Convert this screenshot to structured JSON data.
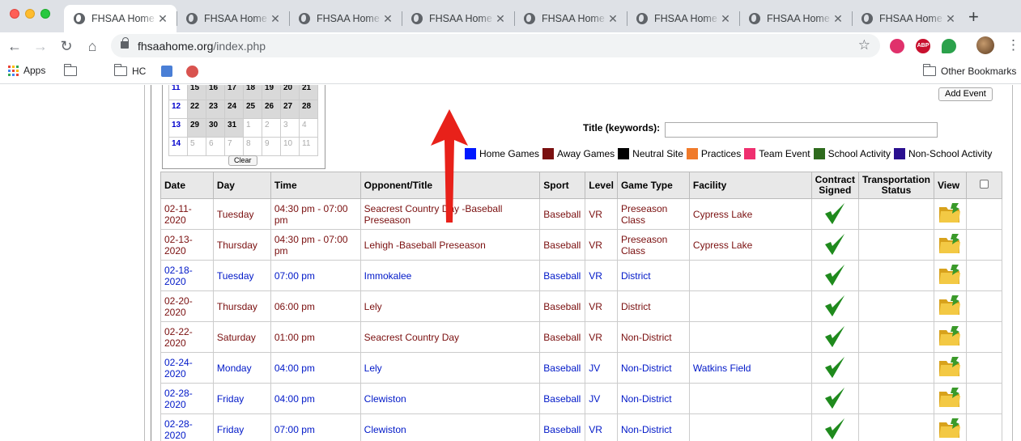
{
  "browser": {
    "tabs": [
      {
        "title": "FHSAA Home"
      },
      {
        "title": "FHSAA Home"
      },
      {
        "title": "FHSAA Home"
      },
      {
        "title": "FHSAA Home"
      },
      {
        "title": "FHSAA Home"
      },
      {
        "title": "FHSAA Home"
      },
      {
        "title": "FHSAA Home"
      },
      {
        "title": "FHSAA Home"
      }
    ],
    "address": {
      "host": "fhsaahome.org",
      "path": "/index.php"
    },
    "ext_abp": "ABP",
    "bookmarks": {
      "apps": "Apps",
      "hc": "HC",
      "other": "Other Bookmarks"
    }
  },
  "calendar": {
    "rows": [
      {
        "week": "11",
        "days": [
          "15",
          "16",
          "17",
          "18",
          "19",
          "20",
          "21"
        ],
        "next": [
          false,
          false,
          false,
          false,
          false,
          false,
          false
        ]
      },
      {
        "week": "12",
        "days": [
          "22",
          "23",
          "24",
          "25",
          "26",
          "27",
          "28"
        ],
        "next": [
          false,
          false,
          false,
          false,
          false,
          false,
          false
        ]
      },
      {
        "week": "13",
        "days": [
          "29",
          "30",
          "31",
          "1",
          "2",
          "3",
          "4"
        ],
        "next": [
          false,
          false,
          false,
          true,
          true,
          true,
          true
        ]
      },
      {
        "week": "14",
        "days": [
          "5",
          "6",
          "7",
          "8",
          "9",
          "10",
          "11"
        ],
        "next": [
          true,
          true,
          true,
          true,
          true,
          true,
          true
        ]
      }
    ],
    "clear_label": "Clear"
  },
  "toolbar": {
    "add_event_label": "Add Event",
    "title_label": "Title (keywords):",
    "title_value": ""
  },
  "legend": [
    {
      "label": "Home Games",
      "color": "#0018ff"
    },
    {
      "label": "Away Games",
      "color": "#7a0f0f"
    },
    {
      "label": "Neutral Site",
      "color": "#000000"
    },
    {
      "label": "Practices",
      "color": "#f07a2a"
    },
    {
      "label": "Team Event",
      "color": "#ef2f6f"
    },
    {
      "label": "School Activity",
      "color": "#2e6b1d"
    },
    {
      "label": "Non-School Activity",
      "color": "#2a0f8f"
    }
  ],
  "table": {
    "headers": [
      "Date",
      "Day",
      "Time",
      "Opponent/Title",
      "Sport",
      "Level",
      "Game Type",
      "Facility",
      "Contract Signed",
      "Transportation Status",
      "View"
    ],
    "rows": [
      {
        "date": "02-11-2020",
        "day": "Tuesday",
        "time": "04:30 pm - 07:00 pm",
        "opponent": "Seacrest Country Day -Baseball Preseason",
        "sport": "Baseball",
        "level": "VR",
        "type": "Preseason Class",
        "facility": "Cypress Lake",
        "color": "#7a0f0f"
      },
      {
        "date": "02-13-2020",
        "day": "Thursday",
        "time": "04:30 pm - 07:00 pm",
        "opponent": "Lehigh -Baseball Preseason",
        "sport": "Baseball",
        "level": "VR",
        "type": "Preseason Class",
        "facility": "Cypress Lake",
        "color": "#7a0f0f"
      },
      {
        "date": "02-18-2020",
        "day": "Tuesday",
        "time": "07:00 pm",
        "opponent": "Immokalee",
        "sport": "Baseball",
        "level": "VR",
        "type": "District",
        "facility": "",
        "color": "#0018c8"
      },
      {
        "date": "02-20-2020",
        "day": "Thursday",
        "time": "06:00 pm",
        "opponent": "Lely",
        "sport": "Baseball",
        "level": "VR",
        "type": "District",
        "facility": "",
        "color": "#7a0f0f"
      },
      {
        "date": "02-22-2020",
        "day": "Saturday",
        "time": "01:00 pm",
        "opponent": "Seacrest Country Day",
        "sport": "Baseball",
        "level": "VR",
        "type": "Non-District",
        "facility": "",
        "color": "#7a0f0f"
      },
      {
        "date": "02-24-2020",
        "day": "Monday",
        "time": "04:00 pm",
        "opponent": "Lely",
        "sport": "Baseball",
        "level": "JV",
        "type": "Non-District",
        "facility": "Watkins Field",
        "color": "#0018c8"
      },
      {
        "date": "02-28-2020",
        "day": "Friday",
        "time": "04:00 pm",
        "opponent": "Clewiston",
        "sport": "Baseball",
        "level": "JV",
        "type": "Non-District",
        "facility": "",
        "color": "#0018c8"
      },
      {
        "date": "02-28-2020",
        "day": "Friday",
        "time": "07:00 pm",
        "opponent": "Clewiston",
        "sport": "Baseball",
        "level": "VR",
        "type": "Non-District",
        "facility": "",
        "color": "#0018c8"
      }
    ]
  }
}
